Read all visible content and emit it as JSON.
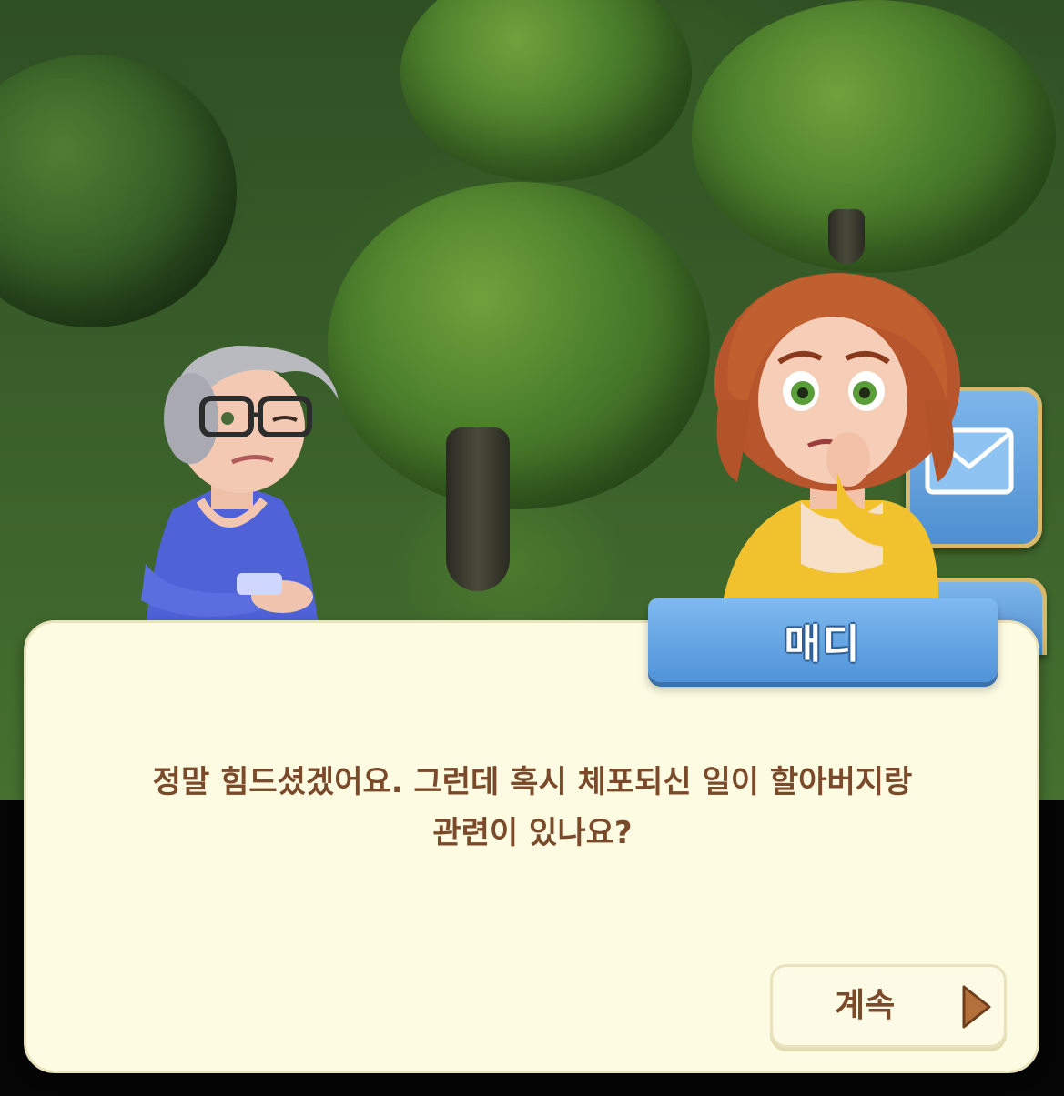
{
  "dialog": {
    "speaker_name": "매디",
    "text": "정말 힘드셨겠어요. 그런데 혹시 체포되신 일이 할아버지랑\n관련이 있나요?",
    "continue_label": "계속"
  },
  "characters": [
    {
      "role": "grandmother",
      "icon": "grandma-character"
    },
    {
      "role": "speaker",
      "icon": "madi-character"
    }
  ],
  "side_buttons": [
    {
      "icon": "mail-icon"
    },
    {
      "icon": "menu-button-icon"
    }
  ],
  "colors": {
    "panel_bg": "#fdfbe2",
    "name_tag": "#5b9de0",
    "text": "#7b4a2a",
    "arrow": "#b3703a"
  }
}
